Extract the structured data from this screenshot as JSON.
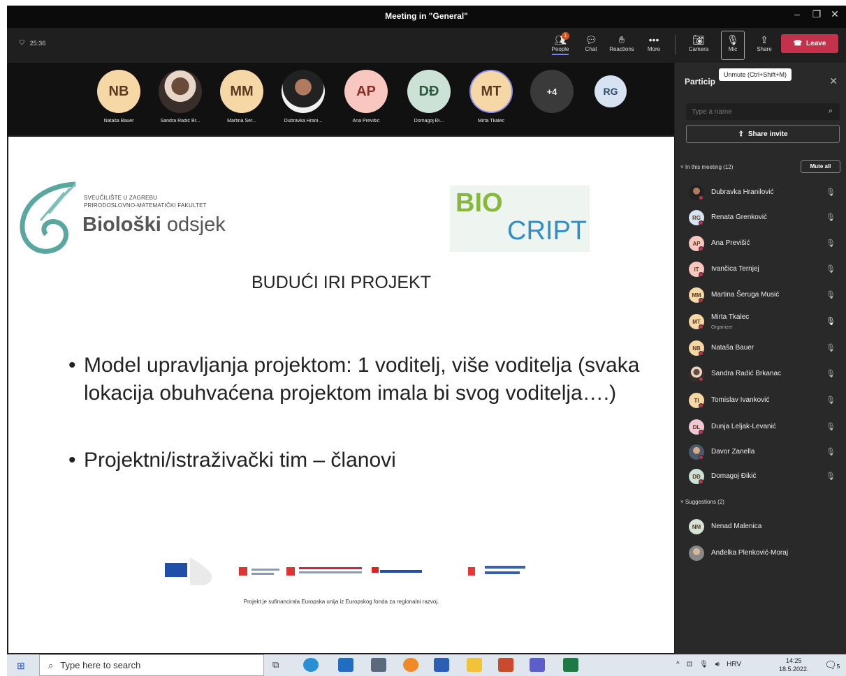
{
  "window": {
    "title": "Meeting in \"General\"",
    "minimize": "–",
    "restore": "❐",
    "close": "✕"
  },
  "toolbar": {
    "timer": "25:36",
    "people_label": "People",
    "people_badge": "1",
    "chat_label": "Chat",
    "reactions_label": "Reactions",
    "more_label": "More",
    "camera_label": "Camera",
    "mic_label": "Mic",
    "share_label": "Share",
    "leave_label": "Leave"
  },
  "strip": {
    "tiles": [
      {
        "initials": "NB",
        "name": "Nataša Bauer"
      },
      {
        "initials": "",
        "name": "Sandra Radić Br..."
      },
      {
        "initials": "MM",
        "name": "Martina Šer..."
      },
      {
        "initials": "",
        "name": "Dubravka Hrani..."
      },
      {
        "initials": "AP",
        "name": "Ana Previšić"
      },
      {
        "initials": "DĐ",
        "name": "Domagoj Đi..."
      },
      {
        "initials": "MT",
        "name": "Mirta Tkalec"
      },
      {
        "initials": "+4",
        "name": ""
      },
      {
        "initials": "RG",
        "name": ""
      }
    ]
  },
  "slide": {
    "logo1_small": "SVEUČILIŠTE U ZAGREBU\nPRIRODOSLOVNO-MATEMATIČKI FAKULTET",
    "logo1_big_bold": "Biološki",
    "logo1_big_rest": " odsjek",
    "logo2_top": "BIO",
    "logo2_bottom": "CRIPT",
    "title": "BUDUĆI IRI PROJEKT",
    "bullet1": "Model upravljanja projektom: 1 voditelj, više voditelja (svaka lokacija obuhvaćena projektom imala bi svog voditelja….)",
    "bullet2": "Projektni/istraživački tim – članovi",
    "footer": "Projekt je sufinancirala Europska unija iz Europskog fonda za regionalni razvoj."
  },
  "panel": {
    "header": "Particip",
    "tooltip": "Unmute (Ctrl+Shift+M)",
    "close": "✕",
    "search_placeholder": "Type a name",
    "share_invite": "Share invite",
    "in_meeting": "In this meeting (12)",
    "mute_all": "Mute all",
    "suggestions": "Suggestions (2)",
    "participants": [
      {
        "initials": "",
        "name": "Dubravka Hranilović",
        "role": "",
        "mic": "🎙︎̸"
      },
      {
        "initials": "RG",
        "name": "Renata Grenković",
        "role": "",
        "mic": "🎙︎̸"
      },
      {
        "initials": "AP",
        "name": "Ana Previšić",
        "role": "",
        "mic": "🎙︎̸"
      },
      {
        "initials": "IT",
        "name": "Ivančica Ternjej",
        "role": "",
        "mic": "🎙︎̸"
      },
      {
        "initials": "MM",
        "name": "Martina Šeruga Musić",
        "role": "",
        "mic": "🎙︎̸"
      },
      {
        "initials": "MT",
        "name": "Mirta Tkalec",
        "role": "Organizer",
        "mic": "🎙︎"
      },
      {
        "initials": "NB",
        "name": "Nataša Bauer",
        "role": "",
        "mic": "🎙︎̸"
      },
      {
        "initials": "",
        "name": "Sandra Radić Brkanac",
        "role": "",
        "mic": "🎙︎̸"
      },
      {
        "initials": "TI",
        "name": "Tomislav Ivanković",
        "role": "",
        "mic": "🎙︎̸"
      },
      {
        "initials": "DL",
        "name": "Dunja Leljak-Levanić",
        "role": "",
        "mic": "🎙︎̸"
      },
      {
        "initials": "",
        "name": "Davor Zanella",
        "role": "",
        "mic": "🎙︎̸"
      },
      {
        "initials": "DĐ",
        "name": "Domagoj Đikić",
        "role": "",
        "mic": "🎙︎̸"
      }
    ],
    "suggested": [
      {
        "initials": "NM",
        "name": "Nenad Malenica"
      },
      {
        "initials": "",
        "name": "Anđelka Plenković-Moraj"
      }
    ]
  },
  "taskbar": {
    "search_placeholder": "Type here to search",
    "lang": "HRV",
    "time": "14:25",
    "date": "18.5.2022.",
    "notif_count": "5"
  }
}
